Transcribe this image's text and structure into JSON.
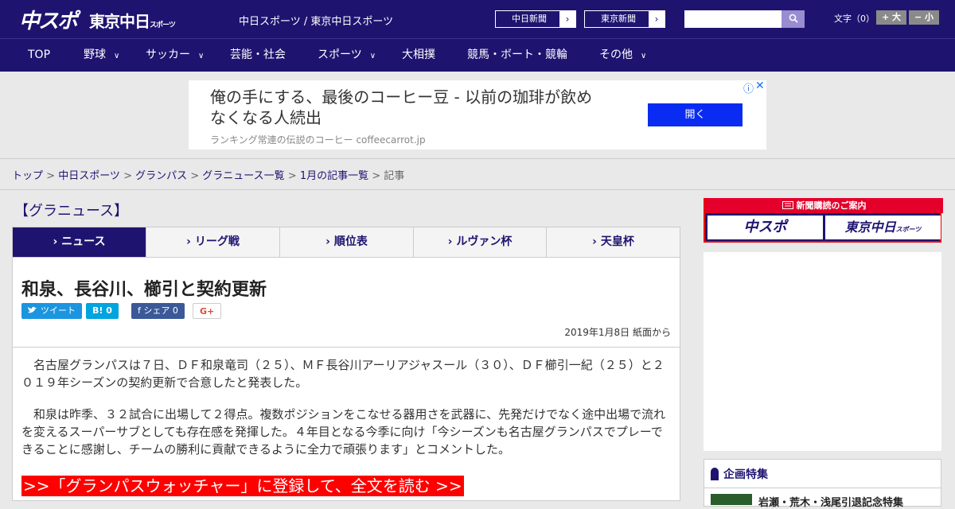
{
  "header": {
    "logo_chuspo": "中スポ",
    "logo_tokyo": "東京中日",
    "logo_tokyo_small": "スポーツ",
    "site_links": "中日スポーツ / 東京中日スポーツ",
    "paper_buttons": [
      "中日新聞",
      "東京新聞"
    ],
    "arrow": "›",
    "search_placeholder": "",
    "search_icon": "search-icon",
    "fontsize_label": "文字（0）",
    "font_larger": "+ 大",
    "font_smaller": "− 小"
  },
  "nav": {
    "items": [
      "TOP",
      "野球",
      "サッカー",
      "芸能・社会",
      "スポーツ",
      "大相撲",
      "競馬・ボート・競輪",
      "その他"
    ],
    "chevron": "∨"
  },
  "ad": {
    "headline": "俺の手にする、最後のコーヒー豆 - 以前の珈琲が飲めなくなる人続出",
    "sub": "ランキング常連の伝説のコーヒー coffeecarrot.jp",
    "button": "開く",
    "info_icon": "ⓘ",
    "close_icon": "✕"
  },
  "breadcrumb": {
    "items": [
      "トップ",
      "中日スポーツ",
      "グランパス",
      "グラニュース一覧",
      "1月の記事一覧"
    ],
    "current": "記事",
    "sep": " > "
  },
  "section": {
    "title": "【グラニュース】",
    "tabs": [
      "ニュース",
      "リーグ戦",
      "順位表",
      "ルヴァン杯",
      "天皇杯"
    ],
    "tab_prefix": "› "
  },
  "article": {
    "title": "和泉、長谷川、櫛引と契約更新",
    "share": {
      "tweet": "ツイート",
      "hatena": "B! 0",
      "facebook": "f シェア 0",
      "gplus": "G+"
    },
    "date": "2019年1月8日 紙面から",
    "paragraphs": [
      "名古屋グランパスは７日、ＤＦ和泉竜司（２５）、ＭＦ長谷川アーリアジャスール（３０）、ＤＦ櫛引一紀（２５）と２０１９年シーズンの契約更新で合意したと発表した。",
      "和泉は昨季、３２試合に出場して２得点。複数ポジションをこなせる器用さを武器に、先発だけでなく途中出場で流れを変えるスーパーサブとしても存在感を発揮した。４年目となる今季に向け「今シーズンも名古屋グランパスでプレーできることに感謝し、チームの勝利に貢献できるように全力で頑張ります」とコメントした。"
    ],
    "cta": ">>「グランパスウォッチャー」に登録して、全文を読む >>"
  },
  "sidebar": {
    "subscription_label": "新聞購読のご案内",
    "sub_logos": [
      "中スポ",
      "東京中日"
    ],
    "sub_logo_small": "スポーツ",
    "feature_title": "企画特集",
    "feature_item": "岩瀬・荒木・浅尾引退記念特集"
  },
  "colors": {
    "brand": "#1e1470",
    "cta": "#ff0000",
    "ad_button": "#0a2cf2",
    "twitter": "#1b95e0",
    "hatena": "#00a4de",
    "facebook": "#3b5998"
  }
}
